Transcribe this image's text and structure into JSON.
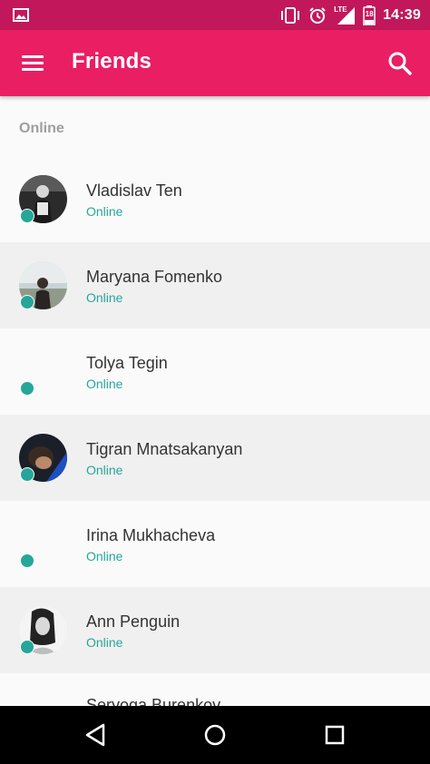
{
  "status_bar": {
    "time": "14:39",
    "network": "LTE",
    "battery_level": "18",
    "icons": [
      "image-icon",
      "vibrate-icon",
      "alarm-icon",
      "signal-icon",
      "battery-icon"
    ]
  },
  "app_bar": {
    "title": "Friends",
    "icons": [
      "menu-icon",
      "search-icon"
    ]
  },
  "section": {
    "header": "Online"
  },
  "friends": [
    {
      "name": "Vladislav Ten",
      "status": "Online"
    },
    {
      "name": "Maryana Fomenko",
      "status": "Online"
    },
    {
      "name": "Tolya Tegin",
      "status": "Online"
    },
    {
      "name": "Tigran Mnatsakanyan",
      "status": "Online"
    },
    {
      "name": "Irina Mukhacheva",
      "status": "Online"
    },
    {
      "name": "Ann Penguin",
      "status": "Online"
    }
  ],
  "partial_item": {
    "name": "Seryoga Burenkov"
  },
  "nav_bar": {
    "icons": [
      "back-icon",
      "home-icon",
      "recents-icon"
    ]
  },
  "colors": {
    "status_bar": "#c2185b",
    "app_bar": "#e91e63",
    "online": "#26a69a",
    "background": "#fafafa",
    "row_alt": "#f0f0f0"
  }
}
